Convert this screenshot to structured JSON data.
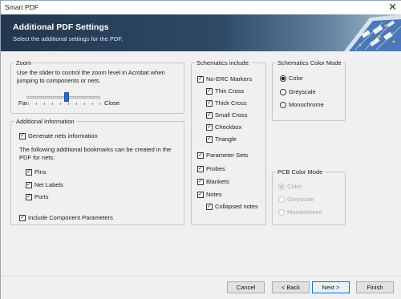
{
  "window": {
    "title": "Smart PDF",
    "close_glyph": "✕"
  },
  "header": {
    "title": "Additional PDF Settings",
    "subtitle": "Select the additional settings for the PDF.",
    "art_icon": "circuit-board-art"
  },
  "zoom": {
    "legend": "Zoom",
    "description": "Use the slider to control the zoom level in Acrobat when jumping to components or nets.",
    "label_far": "Far",
    "label_close": "Close",
    "slider_value_fraction": 0.55
  },
  "additional": {
    "legend": "Additional Information",
    "generate_nets": {
      "label": "Generate nets information",
      "checked": true
    },
    "bookmarks_text": "The following additional bookmarks can be created in the PDF for nets:",
    "pins": {
      "label": "Pins",
      "checked": true
    },
    "net_labels": {
      "label": "Net Labels",
      "checked": true
    },
    "ports": {
      "label": "Ports",
      "checked": true
    },
    "include_component_params": {
      "label": "Include Component Parameters",
      "checked": true
    }
  },
  "schematics_include": {
    "legend": "Schematics include:",
    "items": [
      {
        "label": "No-ERC Markers",
        "checked": true
      },
      {
        "label": "Thin Cross",
        "checked": true
      },
      {
        "label": "Thick Cross",
        "checked": true
      },
      {
        "label": "Small Cross",
        "checked": true
      },
      {
        "label": "Checkbox",
        "checked": true
      },
      {
        "label": "Triangle",
        "checked": true
      },
      {
        "label": "Parameter Sets",
        "checked": true
      },
      {
        "label": "Probes",
        "checked": true
      },
      {
        "label": "Blankets",
        "checked": true
      },
      {
        "label": "Notes",
        "checked": true
      },
      {
        "label": "Collapsed notes",
        "checked": true
      }
    ]
  },
  "schematics_color": {
    "legend": "Schematics Color Mode",
    "options": [
      {
        "label": "Color",
        "selected": true
      },
      {
        "label": "Greyscale",
        "selected": false
      },
      {
        "label": "Monochrome",
        "selected": false
      }
    ]
  },
  "pcb_color": {
    "legend": "PCB Color Mode",
    "options": [
      {
        "label": "Color",
        "selected": true
      },
      {
        "label": "Greyscale",
        "selected": false
      },
      {
        "label": "Monochrome",
        "selected": false
      }
    ],
    "disabled": true
  },
  "buttons": {
    "cancel": "Cancel",
    "back": "< Back",
    "next": "Next >",
    "finish": "Finish"
  },
  "colors": {
    "header_bg": "#23384f",
    "accent": "#0078d7",
    "slider_thumb": "#1f6fd1"
  }
}
